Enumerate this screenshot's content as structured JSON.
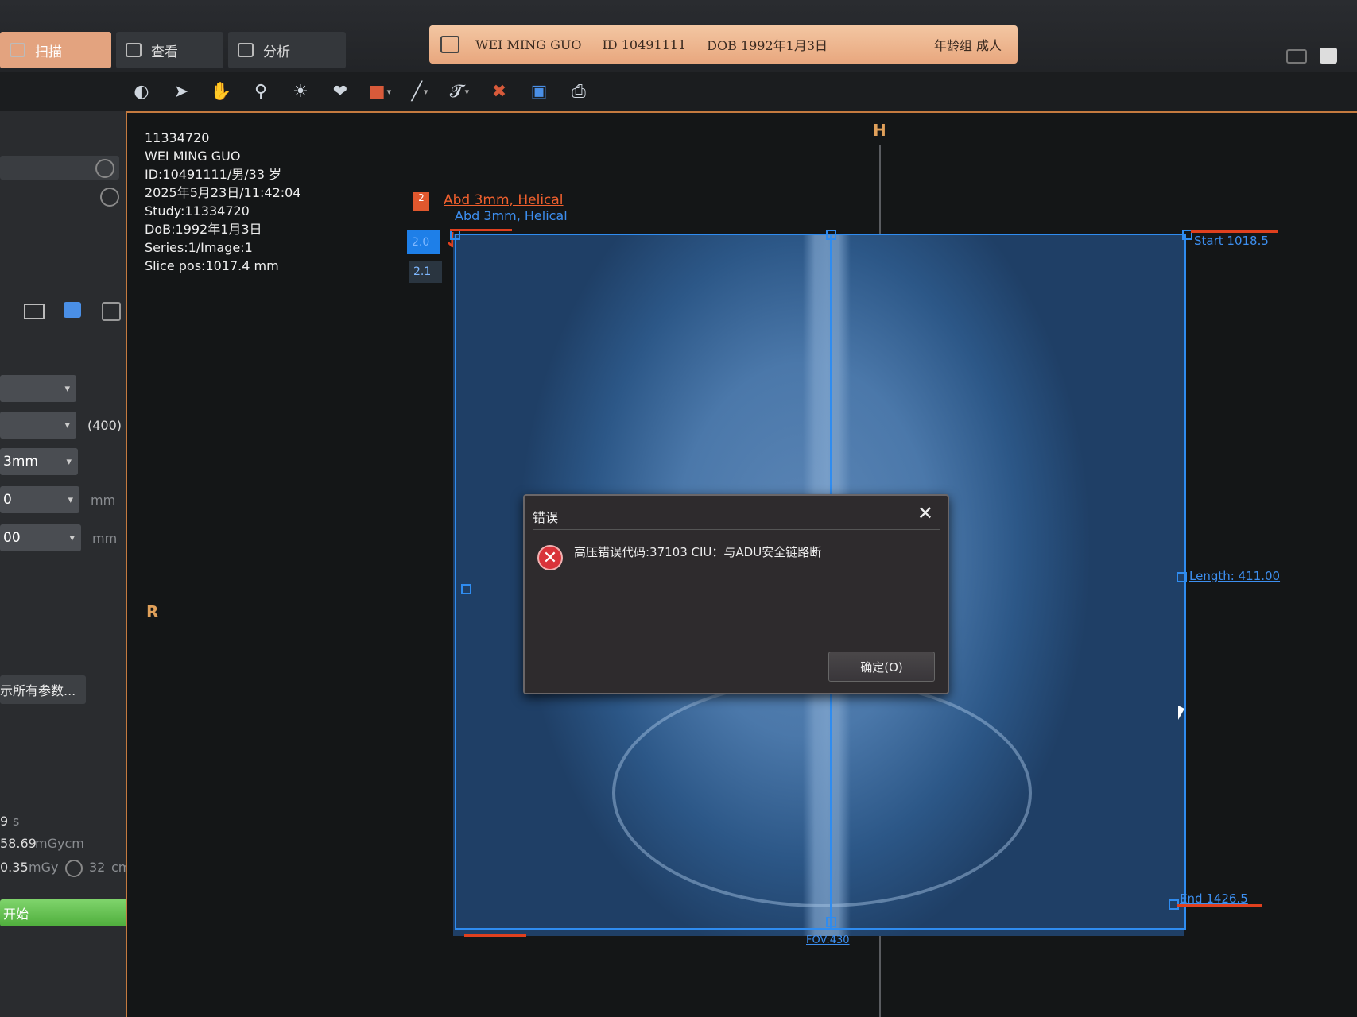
{
  "tabs": {
    "scan": "扫描",
    "view": "查看",
    "analysis": "分析"
  },
  "patient_bar": {
    "name": "WEI MING GUO",
    "id": "ID 10491111",
    "dob": "DOB 1992年1月3日",
    "age_group": "年龄组 成人"
  },
  "left_panel": {
    "value_400": "(400)",
    "slice_thickness": "3mm",
    "field1_value": "0",
    "field2_value": "00",
    "unit_mm": "mm",
    "show_all_params": "示所有参数...",
    "time_value": "9",
    "time_unit": "s",
    "dlp_value": "58.69",
    "dlp_unit": "mGycm",
    "ctdi_value": "0.35",
    "ctdi_unit": "mGy",
    "phantom_value": "32",
    "phantom_unit": "cm",
    "start_button": "开始"
  },
  "image_info": {
    "accession": "11334720",
    "patient_name": "WEI MING GUO",
    "id_line": "ID:10491111/男/33 岁",
    "datetime": "2025年5月23日/11:42:04",
    "study": "Study:11334720",
    "dob": "DoB:1992年1月3日",
    "series": "Series:1/Image:1",
    "slice_pos": "Slice pos:1017.4 mm"
  },
  "orientation": {
    "top": "H",
    "left": "R"
  },
  "scan_plan": {
    "tag": "2",
    "protocol_primary": "Abd 3mm, Helical",
    "protocol_secondary": "Abd 3mm, Helical",
    "box_a": "2.0",
    "box_b": "2.1",
    "start_label": "Start 1018.5",
    "length_label": "Length: 411.00",
    "end_label": "End 1426.5",
    "fov_label": "FOV:430"
  },
  "dialog": {
    "title": "错误",
    "message": "高压错误代码:37103 CIU：与ADU安全链路断",
    "ok_button": "确定(O)"
  },
  "colors": {
    "accent_orange": "#e8a77e",
    "scan_blue": "#2f8cf0",
    "error_red": "#d9333a",
    "start_green": "#4fae3c"
  }
}
